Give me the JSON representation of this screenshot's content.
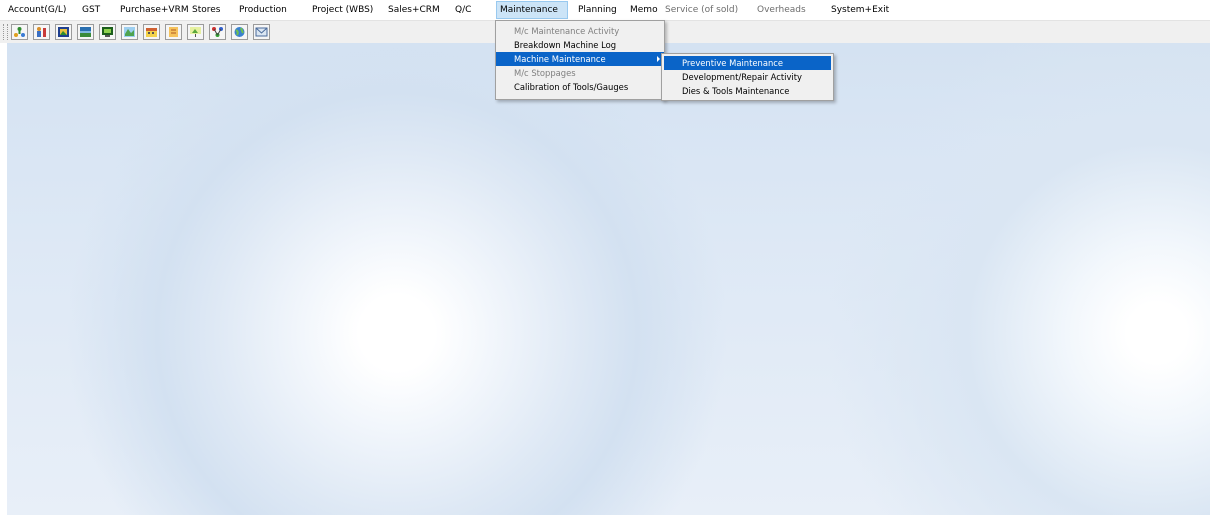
{
  "menubar": {
    "items": [
      {
        "label": "Account(G/L)",
        "disabled": false
      },
      {
        "label": "GST",
        "disabled": false
      },
      {
        "label": "Purchase+VRM",
        "disabled": false
      },
      {
        "label": "Stores",
        "disabled": false
      },
      {
        "label": "Production",
        "disabled": false
      },
      {
        "label": "Project (WBS)",
        "disabled": false
      },
      {
        "label": "Sales+CRM",
        "disabled": false
      },
      {
        "label": "Q/C",
        "disabled": false
      },
      {
        "label": "Maintenance",
        "disabled": false,
        "active": true
      },
      {
        "label": "Planning",
        "disabled": false
      },
      {
        "label": "Memo",
        "disabled": false
      },
      {
        "label": "Service (of sold)",
        "disabled": true
      },
      {
        "label": "Overheads",
        "disabled": true
      },
      {
        "label": "System+Exit",
        "disabled": false
      }
    ]
  },
  "toolbar": {
    "buttons": [
      {
        "icon": "people-tree-icon"
      },
      {
        "icon": "user-chart-icon"
      },
      {
        "icon": "picture-frame-icon"
      },
      {
        "icon": "landscape-icon"
      },
      {
        "icon": "monitor-icon"
      },
      {
        "icon": "map-icon"
      },
      {
        "icon": "calendar-icon"
      },
      {
        "icon": "notes-icon"
      },
      {
        "icon": "presentation-icon"
      },
      {
        "icon": "network-icon"
      },
      {
        "icon": "globe-icon"
      },
      {
        "icon": "envelope-icon"
      }
    ]
  },
  "maintenance_menu": {
    "items": [
      {
        "label": "M/c Maintenance Activity",
        "disabled": true
      },
      {
        "label": "Breakdown Machine Log",
        "disabled": false
      },
      {
        "label": "Machine Maintenance",
        "disabled": false,
        "highlight": true,
        "submenu": true
      },
      {
        "label": "M/c Stoppages",
        "disabled": true
      },
      {
        "label": "Calibration of Tools/Gauges",
        "disabled": false
      }
    ]
  },
  "machine_maintenance_submenu": {
    "items": [
      {
        "label": "Preventive Maintenance",
        "highlight": true
      },
      {
        "label": "Development/Repair Activity",
        "highlight": false
      },
      {
        "label": "Dies & Tools Maintenance",
        "highlight": false
      }
    ]
  },
  "colors": {
    "highlight": "#0a64c8",
    "menu_active_bg": "#cce4f7",
    "background_blue": "#d4e2f2"
  }
}
